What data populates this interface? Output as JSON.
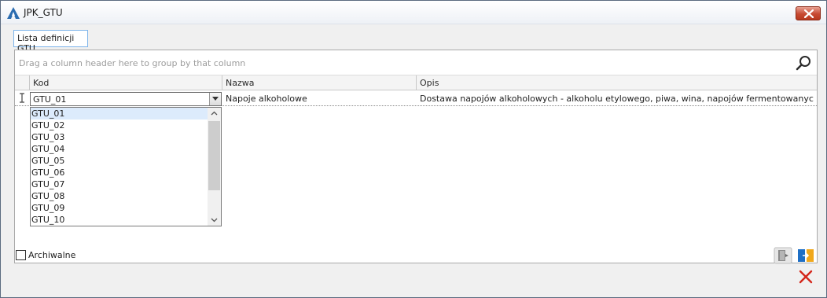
{
  "window": {
    "title": "JPK_GTU"
  },
  "tab": {
    "label": "Lista definicji GTU"
  },
  "grid": {
    "group_hint": "Drag a column header here to group by that column",
    "columns": [
      "Kod",
      "Nazwa",
      "Opis"
    ],
    "rows": [
      {
        "kod": "GTU_01",
        "nazwa": "Napoje alkoholowe",
        "opis": "Dostawa napojów alkoholowych - alkoholu etylowego, piwa, wina, napojów fermentowanych i wyrobó..."
      }
    ]
  },
  "dropdown": {
    "selected": "GTU_01",
    "options": [
      "GTU_01",
      "GTU_02",
      "GTU_03",
      "GTU_04",
      "GTU_05",
      "GTU_06",
      "GTU_07",
      "GTU_08",
      "GTU_09",
      "GTU_10"
    ]
  },
  "footer": {
    "archived_label": "Archiwalne",
    "archived_checked": false
  },
  "icons": {
    "app": "app-logo-icon",
    "close": "close-icon",
    "search": "search-icon",
    "exit": "exit-door-icon",
    "export": "export-icon",
    "cancel": "cancel-x-icon"
  },
  "colors": {
    "accent": "#3b7dd8",
    "close_red": "#c74a32",
    "selection": "#dcebfc"
  }
}
